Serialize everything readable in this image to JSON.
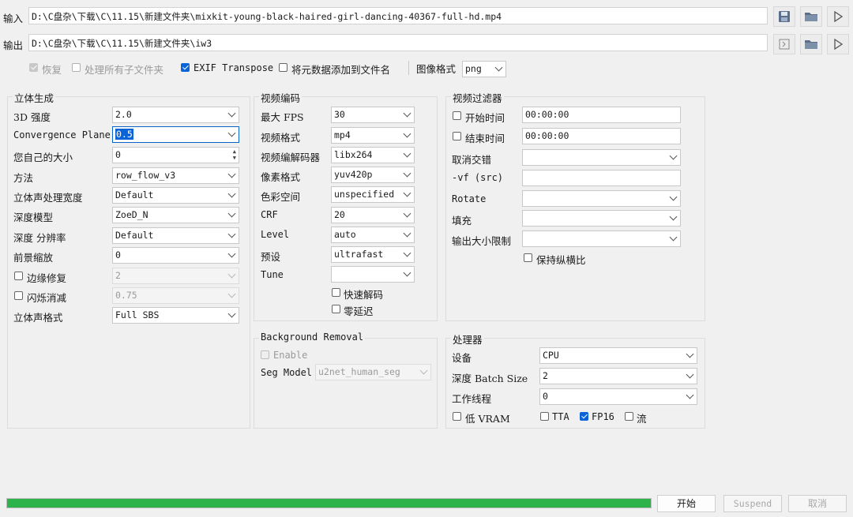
{
  "top": {
    "input_label": "输入",
    "input_path": "D:\\C盘杂\\下载\\C\\11.15\\新建文件夹\\mixkit-young-black-haired-girl-dancing-40367-full-hd.mp4",
    "output_label": "输出",
    "output_path": "D:\\C盘杂\\下载\\C\\11.15\\新建文件夹\\iw3",
    "icons": {
      "save": "save-icon",
      "folder": "folder-icon",
      "play": "play-icon",
      "open_output": "open-output-icon"
    }
  },
  "options": {
    "resume_label": "恢复",
    "resume_checked": true,
    "resume_disabled": true,
    "recursive_label": "处理所有子文件夹",
    "recursive_checked": false,
    "exif_label": "EXIF Transpose",
    "exif_checked": true,
    "metadata_label": "将元数据添加到文件名",
    "metadata_checked": false,
    "image_format_label": "图像格式",
    "image_format_value": "png"
  },
  "stereo": {
    "title": "立体生成",
    "strength_label": "3D 强度",
    "strength_value": "2.0",
    "convergence_label": "Convergence Plane",
    "convergence_value": "0.5",
    "custom_size_label": "您自己的大小",
    "custom_size_value": "0",
    "method_label": "方法",
    "method_value": "row_flow_v3",
    "stereo_width_label": "立体声处理宽度",
    "stereo_width_value": "Default",
    "depth_model_label": "深度模型",
    "depth_model_value": "ZoeD_N",
    "depth_res_label": "深度 分辨率",
    "depth_res_value": "Default",
    "foreground_label": "前景缩放",
    "foreground_value": "0",
    "edge_fix_label": "边缘修复",
    "edge_fix_checked": false,
    "edge_fix_value": "2",
    "flicker_label": "闪烁消减",
    "flicker_checked": false,
    "flicker_value": "0.75",
    "stereo_format_label": "立体声格式",
    "stereo_format_value": "Full SBS"
  },
  "video_encoding": {
    "title": "视频编码",
    "max_fps_label": "最大 FPS",
    "max_fps_value": "30",
    "format_label": "视频格式",
    "format_value": "mp4",
    "codec_label": "视频编解码器",
    "codec_value": "libx264",
    "pix_fmt_label": "像素格式",
    "pix_fmt_value": "yuv420p",
    "colorspace_label": "色彩空间",
    "colorspace_value": "unspecified",
    "crf_label": "CRF",
    "crf_value": "20",
    "level_label": "Level",
    "level_value": "auto",
    "preset_label": "预设",
    "preset_value": "ultrafast",
    "tune_label": "Tune",
    "tune_value": "",
    "fast_decode_label": "快速解码",
    "fast_decode_checked": false,
    "zero_latency_label": "零延迟",
    "zero_latency_checked": false
  },
  "background_removal": {
    "title": "Background Removal",
    "enable_label": "Enable",
    "enable_checked": false,
    "seg_model_label": "Seg Model",
    "seg_model_value": "u2net_human_seg"
  },
  "video_filter": {
    "title": "视频过滤器",
    "start_time_label": "开始时间",
    "start_time_checked": false,
    "start_time_value": "00:00:00",
    "end_time_label": "结束时间",
    "end_time_checked": false,
    "end_time_value": "00:00:00",
    "deinterlace_label": "取消交错",
    "deinterlace_value": "",
    "vf_label": "-vf (src)",
    "vf_value": "",
    "rotate_label": "Rotate",
    "rotate_value": "",
    "pad_label": "填充",
    "pad_value": "",
    "max_output_label": "输出大小限制",
    "max_output_value": "",
    "keep_aspect_label": "保持纵横比",
    "keep_aspect_checked": false
  },
  "processor": {
    "title": "处理器",
    "device_label": "设备",
    "device_value": "CPU",
    "batch_label": "深度 Batch Size",
    "batch_value": "2",
    "threads_label": "工作线程",
    "threads_value": "0",
    "low_vram_label": "低 VRAM",
    "low_vram_checked": false,
    "tta_label": "TTA",
    "tta_checked": false,
    "fp16_label": "FP16",
    "fp16_checked": true,
    "stream_label": "流",
    "stream_checked": false
  },
  "footer": {
    "progress": 1.0,
    "progress_color": "#2eb24a",
    "start_label": "开始",
    "suspend_label": "Suspend",
    "cancel_label": "取消"
  }
}
